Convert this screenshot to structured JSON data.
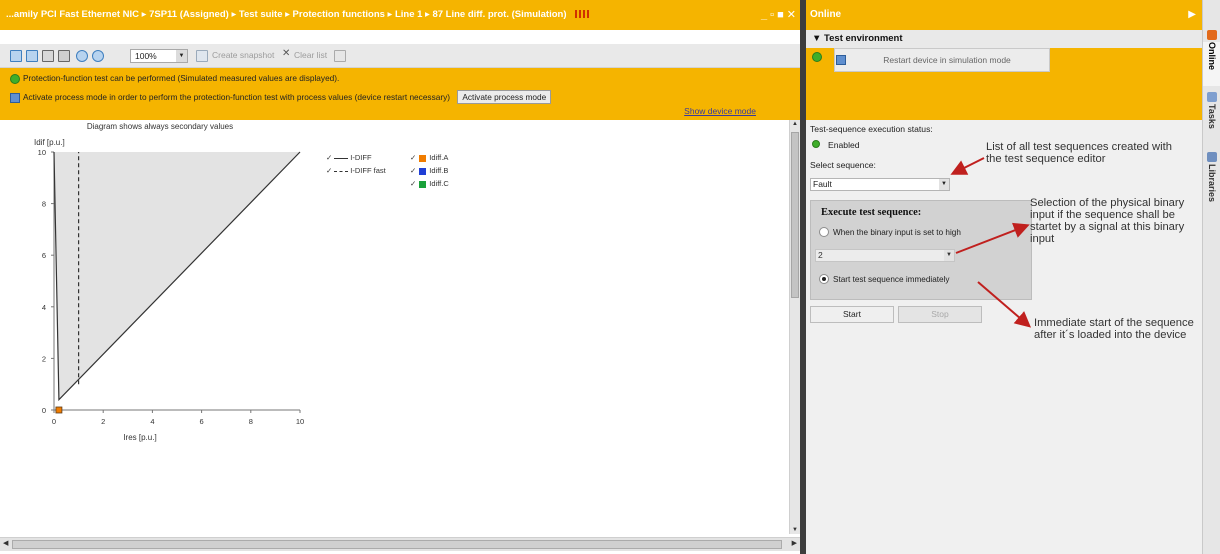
{
  "editor": {
    "breadcrumb": "...amily PCI Fast Ethernet NIC  ▸  7SP11 (Assigned)  ▸  Test suite  ▸  Protection functions  ▸  Line 1  ▸  87 Line diff. prot. (Simulation)",
    "window_controls": "_ ▫ ■ ✕"
  },
  "toolbar": {
    "zoom_value": "100%",
    "create_snapshot": "Create snapshot",
    "clear_list": "Clear list"
  },
  "info": {
    "line1": "Protection-function test can be performed (Simulated measured values are displayed).",
    "line2": "Activate process mode in order to perform the protection-function test with process values (device restart necessary)",
    "activate_button": "Activate process mode",
    "show_device_mode": "Show device mode"
  },
  "chart_data": {
    "type": "line",
    "title": "Diagram shows always secondary values",
    "xlabel": "Ires [p.u.]",
    "ylabel": "Idif [p.u.]",
    "xlim": [
      0,
      10
    ],
    "ylim": [
      0,
      10
    ],
    "xticks": [
      0,
      2,
      4,
      6,
      8,
      10
    ],
    "yticks": [
      0,
      2,
      4,
      6,
      8,
      10
    ],
    "series": [
      {
        "name": "I-DIFF",
        "style": "solid",
        "color": "#333333",
        "x": [
          0,
          0.2,
          10
        ],
        "y": [
          10,
          0.4,
          10
        ]
      },
      {
        "name": "I-DIFF fast",
        "style": "dashed",
        "color": "#333333",
        "x": [
          1,
          1
        ],
        "y": [
          1.0,
          10
        ]
      }
    ],
    "points": [
      {
        "name": "Idiff.A",
        "color": "#f07c00"
      },
      {
        "name": "Idiff.B",
        "color": "#1f3fd6"
      },
      {
        "name": "Idiff.C",
        "color": "#19a13a"
      }
    ],
    "measured": {
      "x": 0.2,
      "y": 0
    },
    "grid": false,
    "legend": "top-right"
  },
  "online": {
    "title": "Online",
    "test_environment": "Test environment",
    "restart_button": "Restart device in simulation mode",
    "status_label": "Test-sequence execution status:",
    "status_value": "Enabled",
    "select_label": "Select sequence:",
    "sequence_value": "Fault",
    "execute_title": "Execute test sequence:",
    "radio_binary": "When the binary input is set to high",
    "binary_value": "2",
    "radio_immediate": "Start test sequence immediately",
    "start": "Start",
    "stop": "Stop"
  },
  "annotations": {
    "a1": "List of all test sequences created with the test sequence editor",
    "a2": "Selection of the physical binary input if the sequence shall be startet by a signal at this binary input",
    "a3": "Immediate start of the sequence after it´s loaded into the device"
  },
  "sidetabs": {
    "online": "Online",
    "tasks": "Tasks",
    "libraries": "Libraries"
  },
  "colors": {
    "accent": "#f5b400",
    "annotation_arrow": "#c0201e"
  }
}
